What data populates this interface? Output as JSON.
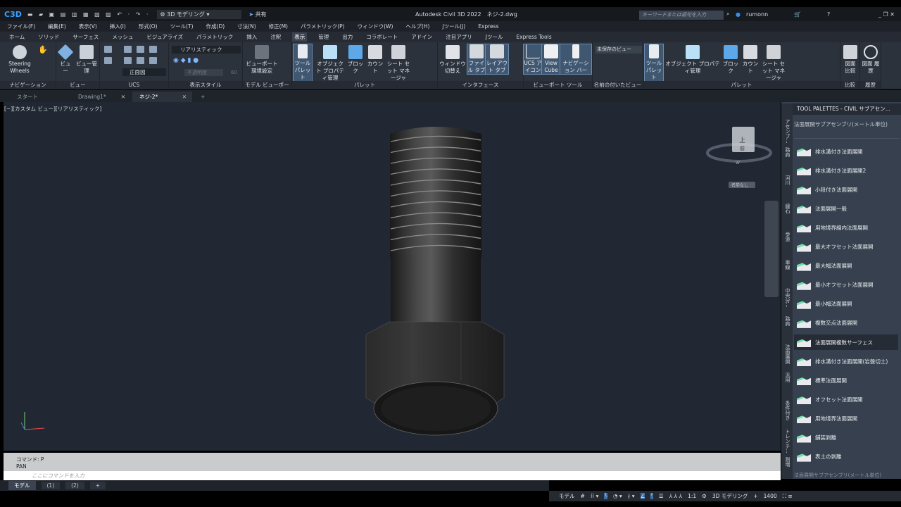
{
  "titlebar": {
    "app_logo": "C3D",
    "workspace": "3D モデリング",
    "share": "共有",
    "title": "Autodesk Civil 3D 2022　ネジ-2.dwg",
    "search_placeholder": "キーワードまたは語句を入力",
    "user": "rumonn"
  },
  "menubar": [
    "ファイル(F)",
    "編集(E)",
    "表示(V)",
    "挿入(I)",
    "形式(O)",
    "ツール(T)",
    "作成(D)",
    "寸法(N)",
    "修正(M)",
    "パラメトリック(P)",
    "ウィンドウ(W)",
    "ヘルプ(H)",
    "Jツール(J)",
    "Express"
  ],
  "ribbon_tabs": [
    "ホーム",
    "ソリッド",
    "サーフェス",
    "メッシュ",
    "ビジュアライズ",
    "パラメトリック",
    "挿入",
    "注釈",
    "表示",
    "管理",
    "出力",
    "コラボレート",
    "アドイン",
    "注目アプリ",
    "Jツール",
    "Express Tools"
  ],
  "active_ribbon_tab": "表示",
  "ribbon": {
    "navigation": {
      "title": "ナビゲーション",
      "steering": "Steering Wheels"
    },
    "view": {
      "title": "ビュー",
      "view": "ビュー",
      "view_manager": "ビュー管理"
    },
    "ucs": {
      "title": "UCS",
      "named_view": "正面図"
    },
    "visual_styles": {
      "title": "表示スタイル",
      "style": "リアリスティック",
      "opacity_label": "不透明度",
      "opacity": "60"
    },
    "model_viewports": {
      "title": "モデル ビューポート",
      "viewport_config": "ビューポート 環境設定"
    },
    "palettes": {
      "title": "パレット",
      "tool_palette": "ツール パレット",
      "obj_props": "オブジェクト プロパティ管理",
      "block": "ブロック",
      "count": "カウント",
      "sheetset": "シート セット マネージャ"
    },
    "interface": {
      "title": "インタフェース",
      "switch_window": "ウィンドウ 切替え",
      "file_tab": "ファイル タブ",
      "layout_tab": "レイアウト タブ"
    },
    "viewport_tools": {
      "title": "ビューポート ツール",
      "ucs_icon": "UCS アイコン",
      "viewcube": "View Cube",
      "navbar": "ナビゲーション バー"
    },
    "named_views": {
      "title": "名前の付いたビュー",
      "unsaved": "未保存のビュー"
    },
    "palettes2": {
      "title": "パレット",
      "tool_palette": "ツール パレット",
      "obj_props": "オブジェクト プロパティ管理",
      "block": "ブロック",
      "count": "カウント",
      "sheetset": "シート セット マネージャ"
    },
    "compare": {
      "title": "比較",
      "label": "図面 比較"
    },
    "history": {
      "title": "履歴",
      "label": "図面 履歴"
    }
  },
  "doc_tabs": [
    {
      "label": "スタート"
    },
    {
      "label": "Drawing1*"
    },
    {
      "label": "ネジ-2*",
      "active": true
    }
  ],
  "viewport": {
    "label": "[−][カスタム ビュー][リアリスティック]",
    "viewcube_face": "上",
    "viewcube_face2": "前",
    "viewcube_w": "W",
    "wcs": "名前なし"
  },
  "palette": {
    "title": "TOOL PALETTES - CIVIL サブアセン...",
    "group": "法面展開サブアセンブリ(メートル単位)",
    "side_tabs": [
      "アセンブ...",
      "路肩",
      "河川",
      "縁石",
      "歩道",
      "車線",
      "中央分...",
      "路肩",
      "法面展開",
      "汎用",
      "条件付き",
      "トレンチ...",
      "割増"
    ],
    "items": [
      "排水溝付き法面展開",
      "排水溝付き法面展開2",
      "小段付き法面展開",
      "法面展開一般",
      "用地境界線内法面展開",
      "最大オフセット法面展開",
      "最大幅法面展開",
      "最小オフセット法面展開",
      "最小幅法面展開",
      "複数交点法面展開",
      "法面展開複数サーフェス",
      "排水溝付き法面展開(岩盤切土)",
      "標準法面展開",
      "オフセット法面展開",
      "用地境界法面展開",
      "舗装剥離",
      "表土の剥離"
    ],
    "highlighted": "法面展開複数サーフェス",
    "footer": "法面展開サブアセンブリ(メートル単位)"
  },
  "command": {
    "history": [
      "コマンド: P",
      "PAN"
    ],
    "placeholder": "ここにコマンドを入力"
  },
  "layout_tabs": [
    "モデル",
    "(1)",
    "(2)",
    "+"
  ],
  "status": {
    "model": "モデル",
    "scale": "1:1",
    "workspace": "3D モデリング",
    "value": "1400"
  }
}
